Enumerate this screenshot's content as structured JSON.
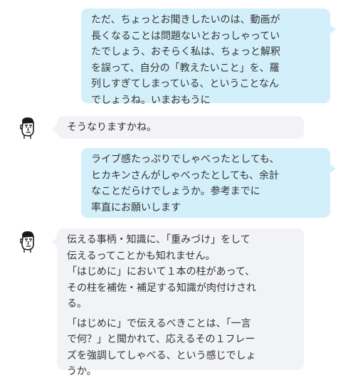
{
  "messages": [
    {
      "role": "user",
      "paragraphs": [
        "ただ、ちょっとお聞きしたいのは、動画が\n長くなることは問題ないとおっしゃってい\nたでしょう、おそらく私は、ちょっと解釈\nを誤って、自分の「教えたいこと」を、羅\n列しすぎてしまっている、ということなん\nでしょうね。いまおもうに"
      ]
    },
    {
      "role": "assistant",
      "avatar": "cartoon-man-face-icon",
      "paragraphs": [
        "そうなりますかね。"
      ]
    },
    {
      "role": "user",
      "paragraphs": [
        "ライブ感たっぷりでしゃべったとしても、\nヒカキンさんがしゃべったとしても、余計\nなことだらけでしょうか。参考までに\n率直にお願いします"
      ]
    },
    {
      "role": "assistant",
      "avatar": "cartoon-man-face-icon",
      "paragraphs": [
        "伝える事柄・知識に、「重みづけ」をして\n伝えるってことかも知れません。\n「はじめに」において１本の柱があって、\nその柱を補佐・補足する知識が肉付けされ\nる。",
        "「はじめに」で伝えるべきことは、「一言\nで何？」と聞かれて、応えるその１フレー\nズを強調してしゃべる、という感じでしょ\nうか。"
      ]
    }
  ]
}
